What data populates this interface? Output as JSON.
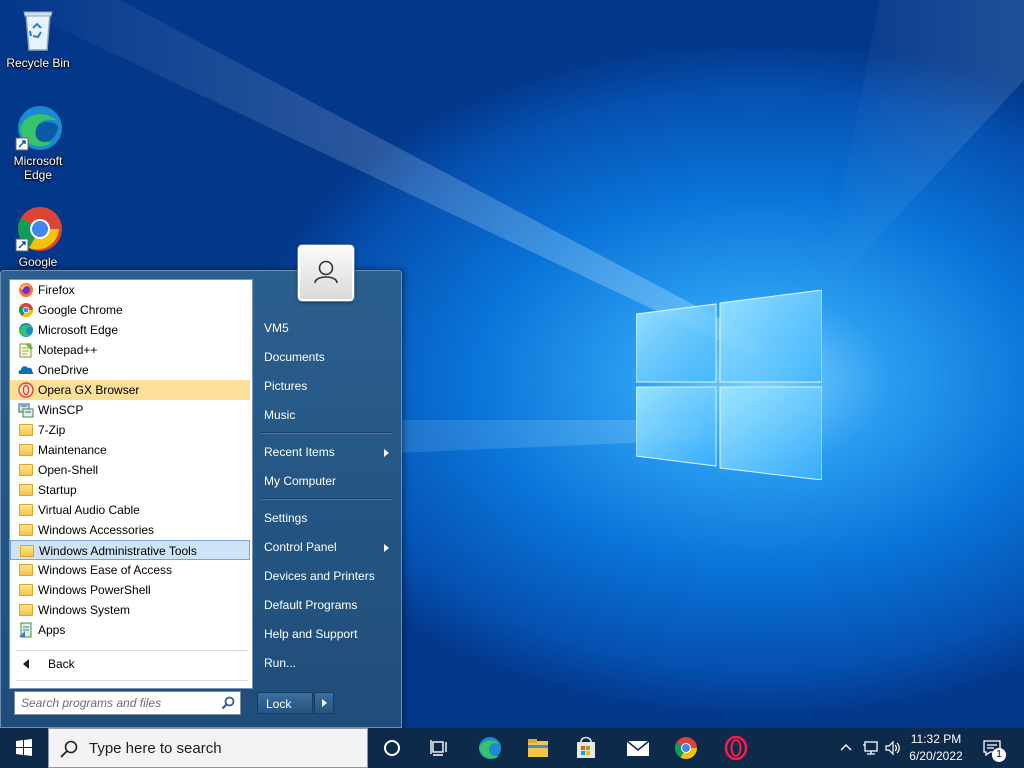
{
  "desktop": {
    "icons": [
      {
        "label": "Recycle Bin",
        "icon": "recycle-bin-icon"
      },
      {
        "label": "Microsoft Edge",
        "icon": "edge-icon"
      },
      {
        "label": "Google",
        "icon": "chrome-icon"
      }
    ]
  },
  "start_menu": {
    "programs": [
      {
        "label": "Firefox",
        "icon": "firefox-icon"
      },
      {
        "label": "Google Chrome",
        "icon": "chrome-icon"
      },
      {
        "label": "Microsoft Edge",
        "icon": "edge-icon"
      },
      {
        "label": "Notepad++",
        "icon": "notepadpp-icon"
      },
      {
        "label": "OneDrive",
        "icon": "onedrive-icon"
      },
      {
        "label": "Opera GX Browser",
        "icon": "opera-gx-icon",
        "highlighted": true
      },
      {
        "label": "WinSCP",
        "icon": "winscp-icon"
      },
      {
        "label": "7-Zip",
        "icon": "folder-icon"
      },
      {
        "label": "Maintenance",
        "icon": "folder-icon"
      },
      {
        "label": "Open-Shell",
        "icon": "folder-icon"
      },
      {
        "label": "Startup",
        "icon": "folder-icon"
      },
      {
        "label": "Virtual Audio Cable",
        "icon": "folder-icon"
      },
      {
        "label": "Windows Accessories",
        "icon": "folder-icon"
      },
      {
        "label": "Windows Administrative Tools",
        "icon": "folder-icon",
        "selected": true
      },
      {
        "label": "Windows Ease of Access",
        "icon": "folder-icon"
      },
      {
        "label": "Windows PowerShell",
        "icon": "folder-icon"
      },
      {
        "label": "Windows System",
        "icon": "folder-icon"
      },
      {
        "label": "Apps",
        "icon": "apps-icon"
      }
    ],
    "back_label": "Back",
    "search_placeholder": "Search programs and files",
    "right_links": [
      {
        "label": "VM5"
      },
      {
        "label": "Documents"
      },
      {
        "label": "Pictures"
      },
      {
        "label": "Music"
      },
      {
        "label": "Recent Items",
        "submenu": true
      },
      {
        "label": "My Computer"
      },
      {
        "label": "Settings"
      },
      {
        "label": "Control Panel",
        "submenu": true
      },
      {
        "label": "Devices and Printers"
      },
      {
        "label": "Default Programs"
      },
      {
        "label": "Help and Support"
      },
      {
        "label": "Run..."
      }
    ],
    "lock_label": "Lock"
  },
  "taskbar": {
    "search_placeholder": "Type here to search",
    "pinned": [
      "cortana-icon",
      "task-view-icon",
      "edge-icon",
      "file-explorer-icon",
      "store-icon",
      "mail-icon",
      "chrome-icon",
      "opera-icon"
    ],
    "clock_time": "11:32 PM",
    "clock_date": "6/20/2022",
    "notification_count": "1"
  },
  "colors": {
    "highlight": "#fddf98",
    "selection": "#cde3f7",
    "taskbar": "#0d2a4a"
  }
}
